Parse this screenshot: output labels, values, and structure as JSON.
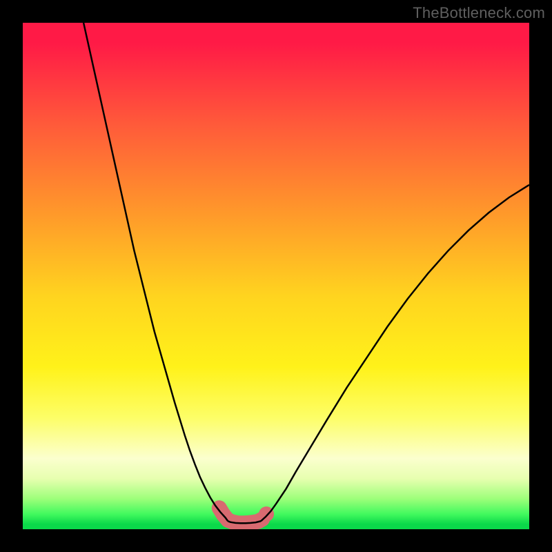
{
  "watermark": "TheBottleneck.com",
  "colors": {
    "brand_text": "#5f5f5f",
    "curve": "#000000",
    "marker": "#d86a70",
    "gradient_top": "#ff1a46",
    "gradient_bottom": "#0bd94a"
  },
  "chart_data": {
    "type": "line",
    "title": "",
    "xlabel": "",
    "ylabel": "",
    "xlim": [
      0,
      100
    ],
    "ylim": [
      0,
      100
    ],
    "grid": false,
    "legend": false,
    "annotations": [],
    "series": [
      {
        "name": "left_curve",
        "x": [
          12,
          14,
          16,
          18,
          20,
          22,
          24,
          26,
          28,
          30,
          32,
          33,
          34,
          35,
          36,
          37,
          38,
          39,
          40,
          40.5
        ],
        "y": [
          100,
          91,
          82,
          73,
          64,
          55,
          47,
          39,
          32,
          25,
          18.5,
          15.5,
          12.8,
          10.3,
          8.2,
          6.3,
          4.7,
          3.4,
          2.3,
          1.6
        ]
      },
      {
        "name": "right_curve",
        "x": [
          47,
          48,
          49,
          50,
          52,
          54,
          57,
          60,
          64,
          68,
          72,
          76,
          80,
          84,
          88,
          92,
          96,
          100
        ],
        "y": [
          1.6,
          2.5,
          3.6,
          5,
          8,
          11.5,
          16.5,
          21.5,
          28,
          34,
          40,
          45.5,
          50.5,
          55,
          59,
          62.5,
          65.5,
          68
        ]
      },
      {
        "name": "floor_segment",
        "x": [
          40.5,
          41,
          42,
          43,
          44,
          45,
          46,
          47
        ],
        "y": [
          1.6,
          1.4,
          1.25,
          1.2,
          1.2,
          1.25,
          1.35,
          1.6
        ]
      }
    ],
    "markers": {
      "name": "highlight_dots",
      "x": [
        38.8,
        39.6,
        40.5,
        41.5,
        42.5,
        43.5,
        44.5,
        45.5,
        46.5,
        47.3,
        48.1
      ],
      "y": [
        4.2,
        2.9,
        1.8,
        1.4,
        1.2,
        1.2,
        1.25,
        1.35,
        1.55,
        2.0,
        3.0
      ]
    }
  }
}
